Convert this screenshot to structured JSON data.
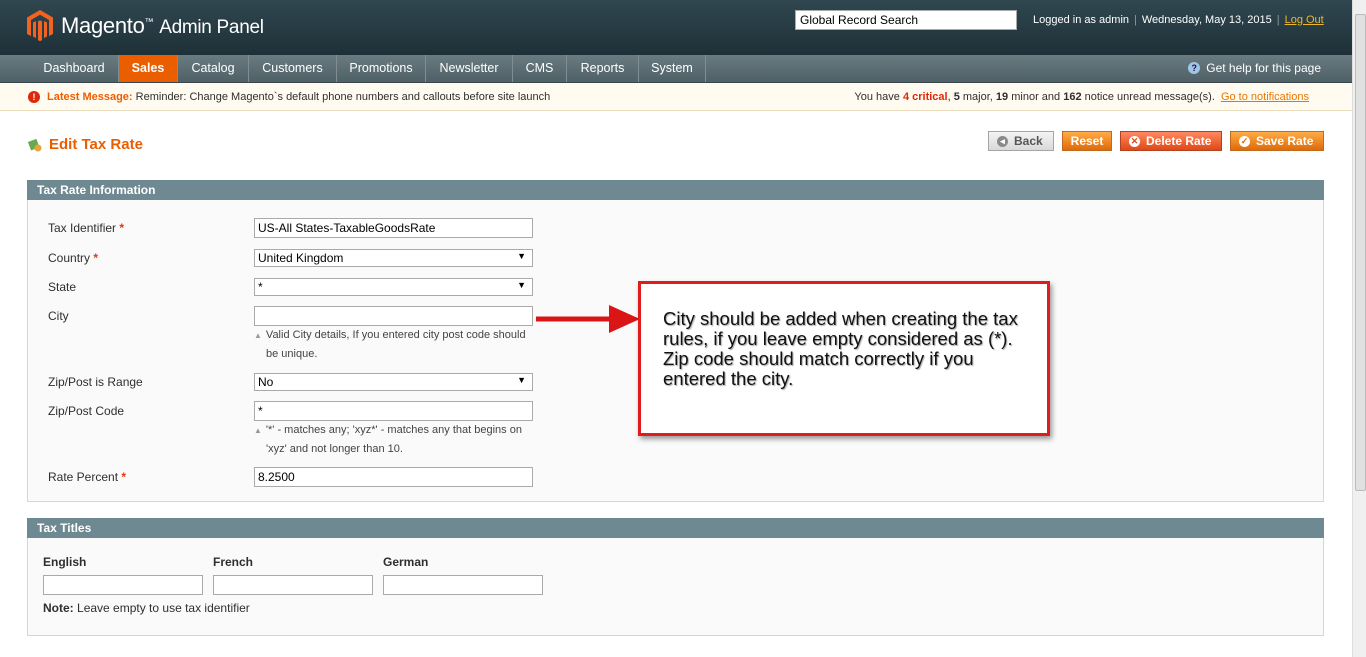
{
  "header": {
    "brand": "Magento",
    "brand_tm": "™",
    "brand_sub": "Admin Panel",
    "search_value": "Global Record Search",
    "logged_in": "Logged in as admin",
    "date": "Wednesday, May 13, 2015",
    "logout": "Log Out"
  },
  "nav": {
    "items": [
      "Dashboard",
      "Sales",
      "Catalog",
      "Customers",
      "Promotions",
      "Newsletter",
      "CMS",
      "Reports",
      "System"
    ],
    "active": "Sales",
    "help": "Get help for this page"
  },
  "message": {
    "label": "Latest Message:",
    "text": "Reminder: Change Magento`s default phone numbers and callouts before site launch",
    "pre": "You have",
    "critical": "4 critical",
    "major_n": "5",
    "major_t": "major,",
    "minor_n": "19",
    "minor_t": "minor and",
    "notice_n": "162",
    "notice_t": "notice unread message(s).",
    "link": "Go to notifications"
  },
  "page": {
    "title": "Edit Tax Rate",
    "buttons": {
      "back": "Back",
      "reset": "Reset",
      "delete": "Delete Rate",
      "save": "Save Rate"
    }
  },
  "tax_rate_info": {
    "heading": "Tax Rate Information",
    "tax_identifier_label": "Tax Identifier",
    "tax_identifier_value": "US-All States-TaxableGoodsRate",
    "country_label": "Country",
    "country_value": "United Kingdom",
    "state_label": "State",
    "state_value": "*",
    "city_label": "City",
    "city_value": "",
    "city_note_1": "Valid City details, If you entered city post code should",
    "city_note_2": "be unique.",
    "zip_range_label": "Zip/Post is Range",
    "zip_range_value": "No",
    "zip_code_label": "Zip/Post Code",
    "zip_code_value": "*",
    "zip_note_1": "'*' - matches any; 'xyz*' - matches any that begins on",
    "zip_note_2": "'xyz' and not longer than 10.",
    "rate_label": "Rate Percent",
    "rate_value": "8.2500",
    "required_mark": "*"
  },
  "tax_titles": {
    "heading": "Tax Titles",
    "english": "English",
    "french": "French",
    "german": "German",
    "note_bold": "Note:",
    "note_text": "Leave empty to use tax identifier"
  },
  "callout": {
    "line1": "City should be added when creating the tax rules, if you leave empty considered as (*).",
    "line2": "Zip code should match correctly if you entered the city."
  },
  "colors": {
    "accent": "#eb5e00",
    "header": "#2a3e46",
    "section": "#6f8992",
    "callout_border": "#e21c1c"
  }
}
